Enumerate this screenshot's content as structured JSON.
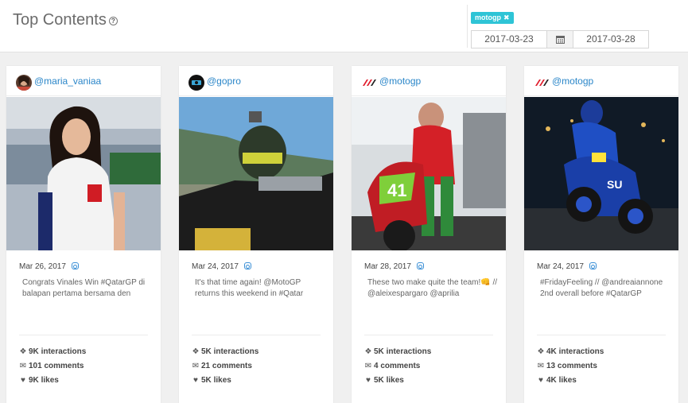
{
  "header": {
    "title": "Top Contents",
    "help_icon_text": "?",
    "tag_label": "motogp",
    "tag_remove": "✖",
    "date_start": "2017-03-23",
    "date_end": "2017-03-28",
    "calendar_icon": "calendar-icon"
  },
  "colors": {
    "accent": "#2ec4d6",
    "link": "#2a86c9",
    "background": "#f0f0f0"
  },
  "cards": [
    {
      "handle": "@maria_vaniaa",
      "date": "Mar 26, 2017",
      "caption": "Congrats Vinales Win #QatarGP di balapan pertama bersama den",
      "interactions": "9K",
      "interactions_label": "interactions",
      "comments": "101",
      "comments_label": "comments",
      "likes": "9K",
      "likes_label": "likes"
    },
    {
      "handle": "@gopro",
      "date": "Mar 24, 2017",
      "caption": "It's that time again! @MotoGP returns this weekend in #Qatar",
      "interactions": "5K",
      "interactions_label": "interactions",
      "comments": "21",
      "comments_label": "comments",
      "likes": "5K",
      "likes_label": "likes"
    },
    {
      "handle": "@motogp",
      "date": "Mar 28, 2017",
      "caption": "These two make quite the team!👊 // @aleixespargaro @aprilia",
      "interactions": "5K",
      "interactions_label": "interactions",
      "comments": "4",
      "comments_label": "comments",
      "likes": "5K",
      "likes_label": "likes"
    },
    {
      "handle": "@motogp",
      "date": "Mar 24, 2017",
      "caption": "#FridayFeeling // @andreaiannone 2nd overall before #QatarGP",
      "interactions": "4K",
      "interactions_label": "interactions",
      "comments": "13",
      "comments_label": "comments",
      "likes": "4K",
      "likes_label": "likes"
    }
  ]
}
